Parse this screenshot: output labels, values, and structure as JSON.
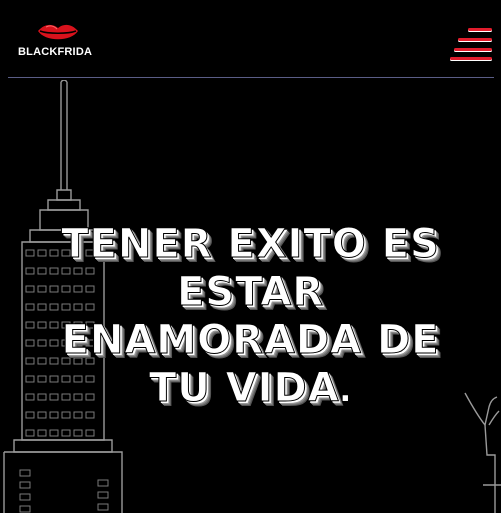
{
  "brand": {
    "logo_text": "BLACKFRIDA",
    "accent_color": "#e21c2c"
  },
  "header": {
    "menu_icon": "hamburger-menu-icon"
  },
  "hero": {
    "headline_lines": [
      "TENER EXITO ES",
      "ESTAR",
      "ENAMORADA DE",
      "TU VIDA"
    ],
    "headline_end": "."
  },
  "decorations": {
    "left": "skyline-building-illustration",
    "right": "statue-illustration"
  }
}
